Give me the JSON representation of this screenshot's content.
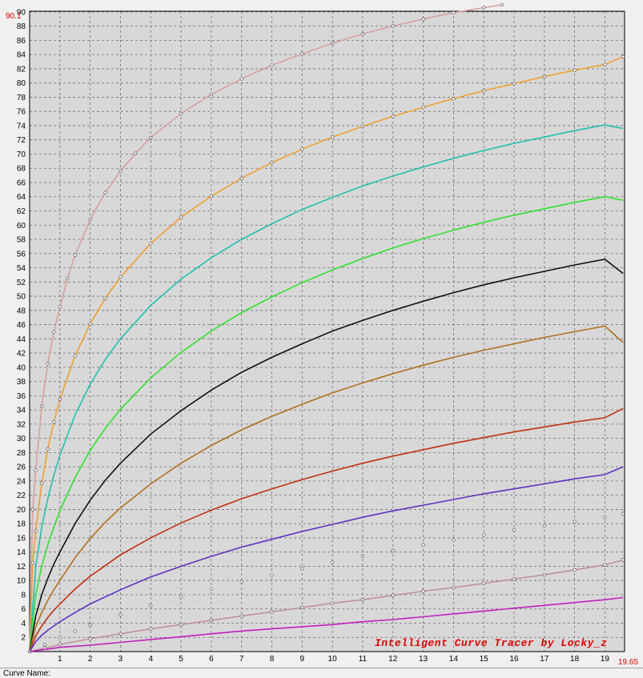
{
  "window": {
    "curve_name_label": "Curve Name:",
    "watermark": "Intelligent Curve Tracer by Locky_z",
    "y_max_marker": "90.1",
    "x_max_marker": "19.65"
  },
  "colors": {
    "plot_bg": "#d8d8d8",
    "grid": "#707070",
    "marker_text": "#e00000",
    "watermark": "#e00000"
  },
  "chart_data": {
    "type": "line",
    "title": "",
    "xlabel": "",
    "ylabel": "",
    "xlim": [
      0,
      19.65
    ],
    "ylim": [
      0,
      90.1
    ],
    "grid": true,
    "x_ticks": [
      1,
      2,
      3,
      4,
      5,
      6,
      7,
      8,
      9,
      10,
      11,
      12,
      13,
      14,
      15,
      16,
      17,
      18,
      19
    ],
    "y_ticks": [
      2,
      4,
      6,
      8,
      10,
      12,
      14,
      16,
      18,
      20,
      22,
      24,
      26,
      28,
      30,
      32,
      34,
      36,
      38,
      40,
      42,
      44,
      46,
      48,
      50,
      52,
      54,
      56,
      58,
      60,
      62,
      64,
      66,
      68,
      70,
      72,
      74,
      76,
      78,
      80,
      82,
      84,
      86,
      88,
      90
    ],
    "series": [
      {
        "color": "#d8a0a0",
        "style": "solid-markers",
        "x": [
          0,
          0.1,
          0.2,
          0.4,
          0.6,
          0.8,
          1,
          1.25,
          1.5,
          2,
          2.5,
          3,
          3.5,
          4,
          5,
          6,
          7,
          8,
          9,
          10,
          11,
          12,
          13,
          14,
          15,
          15.6
        ],
        "values": [
          0,
          20,
          25.5,
          34.5,
          40.5,
          45,
          48.5,
          52.5,
          55.8,
          60.8,
          64.6,
          67.6,
          70.1,
          72.3,
          75.7,
          78.4,
          80.6,
          82.5,
          84.1,
          85.6,
          86.9,
          88,
          89,
          89.9,
          90.6,
          91
        ]
      },
      {
        "color": "#f0a030",
        "style": "solid-markers",
        "x": [
          0,
          0.1,
          0.2,
          0.4,
          0.6,
          0.8,
          1,
          1.5,
          2,
          2.5,
          3,
          4,
          5,
          6,
          7,
          8,
          9,
          10,
          11,
          12,
          13,
          14,
          15,
          16,
          17,
          18,
          19,
          19.6
        ],
        "values": [
          0,
          12.5,
          17,
          23.7,
          28.5,
          32.3,
          35.5,
          41.6,
          46.1,
          49.7,
          52.7,
          57.4,
          61.1,
          64.1,
          66.6,
          68.8,
          70.7,
          72.4,
          73.9,
          75.3,
          76.6,
          77.8,
          78.9,
          79.9,
          80.9,
          81.8,
          82.6,
          83.7
        ]
      },
      {
        "color": "#20c0b0",
        "style": "solid",
        "x": [
          0,
          0.2,
          0.4,
          0.6,
          0.8,
          1,
          1.5,
          2,
          2.5,
          3,
          4,
          5,
          6,
          7,
          8,
          9,
          10,
          11,
          12,
          13,
          14,
          15,
          16,
          17,
          18,
          19,
          19.6
        ],
        "values": [
          0,
          12,
          17.5,
          21.5,
          24.8,
          27.6,
          33.3,
          37.6,
          41.1,
          44,
          48.7,
          52.4,
          55.4,
          58,
          60.2,
          62.2,
          63.9,
          65.5,
          66.9,
          68.2,
          69.4,
          70.5,
          71.5,
          72.4,
          73.3,
          74.1,
          73.6
        ]
      },
      {
        "color": "#30e030",
        "style": "solid",
        "x": [
          0,
          0.2,
          0.4,
          0.6,
          0.8,
          1,
          1.5,
          2,
          2.5,
          3,
          4,
          5,
          6,
          7,
          8,
          9,
          10,
          11,
          12,
          13,
          14,
          15,
          16,
          17,
          18,
          19,
          19.6
        ],
        "values": [
          0,
          8,
          12,
          15,
          17.5,
          19.8,
          24.5,
          28.3,
          31.4,
          34.1,
          38.5,
          42.1,
          45.1,
          47.7,
          49.9,
          51.9,
          53.7,
          55.3,
          56.8,
          58.1,
          59.3,
          60.4,
          61.4,
          62.3,
          63.2,
          64,
          63.5
        ]
      },
      {
        "color": "#101010",
        "style": "solid",
        "x": [
          0,
          0.2,
          0.4,
          0.6,
          0.8,
          1,
          1.5,
          2,
          2.5,
          3,
          4,
          5,
          6,
          7,
          8,
          9,
          10,
          11,
          12,
          13,
          14,
          15,
          16,
          17,
          18,
          19,
          19.6
        ],
        "values": [
          0,
          5,
          8,
          10.3,
          12.3,
          14,
          18,
          21.3,
          24.1,
          26.5,
          30.6,
          33.9,
          36.8,
          39.3,
          41.4,
          43.3,
          45.1,
          46.6,
          48,
          49.3,
          50.5,
          51.6,
          52.6,
          53.5,
          54.4,
          55.2,
          53.2
        ]
      },
      {
        "color": "#b07020",
        "style": "solid",
        "x": [
          0,
          0.2,
          0.4,
          0.6,
          0.8,
          1,
          1.5,
          2,
          2.5,
          3,
          4,
          5,
          6,
          7,
          8,
          9,
          10,
          11,
          12,
          13,
          14,
          15,
          16,
          17,
          18,
          19,
          19.6
        ],
        "values": [
          0,
          3.5,
          5.5,
          7.2,
          8.7,
          10,
          13.2,
          15.9,
          18.2,
          20.2,
          23.6,
          26.5,
          29,
          31.2,
          33.1,
          34.8,
          36.4,
          37.8,
          39.1,
          40.3,
          41.4,
          42.4,
          43.3,
          44.2,
          45,
          45.8,
          43.5
        ]
      },
      {
        "color": "#c03010",
        "style": "solid",
        "x": [
          0,
          0.2,
          0.4,
          0.6,
          0.8,
          1,
          1.5,
          2,
          3,
          4,
          5,
          6,
          7,
          8,
          9,
          10,
          11,
          12,
          13,
          14,
          15,
          16,
          17,
          18,
          19,
          19.6
        ],
        "values": [
          0,
          2.2,
          3.6,
          4.8,
          5.8,
          6.7,
          8.8,
          10.6,
          13.6,
          16,
          18.1,
          19.9,
          21.5,
          22.9,
          24.2,
          25.4,
          26.5,
          27.5,
          28.4,
          29.3,
          30.1,
          30.9,
          31.6,
          32.3,
          32.9,
          34.2
        ]
      },
      {
        "color": "#6030c0",
        "style": "solid",
        "x": [
          0,
          0.2,
          0.4,
          0.6,
          0.8,
          1,
          1.5,
          2,
          3,
          4,
          5,
          6,
          7,
          8,
          9,
          10,
          11,
          12,
          13,
          14,
          15,
          16,
          17,
          18,
          19,
          19.6
        ],
        "values": [
          0,
          1.4,
          2.3,
          3,
          3.6,
          4.2,
          5.5,
          6.7,
          8.7,
          10.5,
          12,
          13.4,
          14.7,
          15.8,
          16.9,
          17.9,
          18.9,
          19.8,
          20.6,
          21.4,
          22.2,
          22.9,
          23.6,
          24.3,
          24.9,
          26
        ]
      },
      {
        "color": "#b8f0b8",
        "style": "dotted-markers",
        "x": [
          0,
          0.5,
          1,
          1.5,
          2,
          3,
          4,
          5,
          6,
          7,
          8,
          9,
          10,
          11,
          12,
          13,
          14,
          15,
          16,
          17,
          18,
          19,
          19.6
        ],
        "values": [
          0,
          1,
          2,
          2.9,
          3.7,
          5.2,
          6.5,
          7.7,
          8.8,
          9.8,
          10.8,
          11.7,
          12.6,
          13.4,
          14.2,
          15,
          15.7,
          16.4,
          17.1,
          17.7,
          18.3,
          18.9,
          19.4
        ]
      },
      {
        "color": "#c090a0",
        "style": "solid-markers",
        "x": [
          0,
          0.5,
          1,
          2,
          3,
          4,
          5,
          6,
          7,
          8,
          9,
          10,
          11,
          12,
          13,
          14,
          15,
          16,
          17,
          18,
          19,
          19.6
        ],
        "values": [
          0,
          0.5,
          1,
          1.8,
          2.5,
          3.2,
          3.8,
          4.4,
          5,
          5.6,
          6.2,
          6.8,
          7.3,
          7.9,
          8.5,
          9,
          9.6,
          10.2,
          10.8,
          11.5,
          12.2,
          12.9
        ]
      },
      {
        "color": "#c020c0",
        "style": "solid",
        "x": [
          0,
          0.5,
          1,
          2,
          3,
          4,
          5,
          6,
          7,
          8,
          9,
          10,
          11,
          12,
          13,
          14,
          15,
          16,
          17,
          18,
          19,
          19.6
        ],
        "values": [
          0,
          0.3,
          0.6,
          0.9,
          1.3,
          1.7,
          2.1,
          2.5,
          2.9,
          3.2,
          3.5,
          3.8,
          4.2,
          4.5,
          4.9,
          5.3,
          5.7,
          6.1,
          6.5,
          6.9,
          7.3,
          7.6
        ]
      }
    ]
  }
}
